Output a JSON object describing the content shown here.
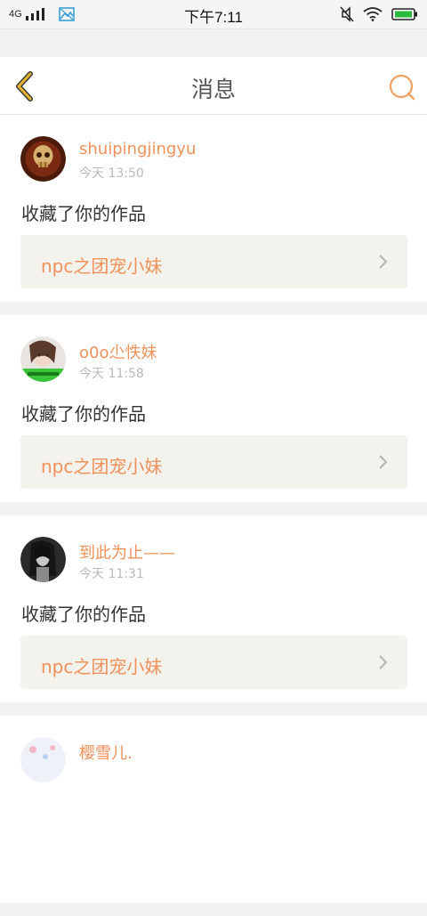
{
  "status_bar": {
    "network": "4G",
    "time": "下午7:11",
    "icons": [
      "signal-icon",
      "gallery-icon",
      "mute-icon",
      "wifi-icon",
      "battery-icon"
    ]
  },
  "header": {
    "title": "消息",
    "back_icon": "back-chevron-icon",
    "search_icon": "search-icon"
  },
  "colors": {
    "accent": "#f0915a",
    "back_icon": "#e2b52c",
    "card_link_bg": "#f3f2ec"
  },
  "messages": [
    {
      "username": "shuipingjingyu",
      "time": "今天 13:50",
      "action": "收藏了你的作品",
      "work_title": "npc之团宠小妹"
    },
    {
      "username": "o0o尐怢妹",
      "time": "今天 11:58",
      "action": "收藏了你的作品",
      "work_title": "npc之团宠小妹"
    },
    {
      "username": "到此为止——",
      "time": "今天 11:31",
      "action": "收藏了你的作品",
      "work_title": "npc之团宠小妹"
    },
    {
      "username": "樱雪儿.",
      "time": "",
      "action": "",
      "work_title": ""
    }
  ]
}
